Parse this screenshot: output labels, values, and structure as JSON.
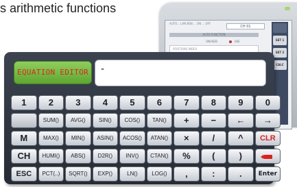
{
  "heading": "s arithmetic functions",
  "device": {
    "top_small": "AUTO...  LAN  BSN  ... ON ... OFF",
    "channel": "CH 01",
    "bar": "AUTO  FUNCTION",
    "opt_unused": "UNUSED",
    "opt_use": "USE",
    "line": "POSITIONS INDEX",
    "side": [
      "SET 1",
      "SET 2",
      "CALC"
    ]
  },
  "editor": {
    "label": "EQUATION EDITOR",
    "value": "-"
  },
  "keypad": {
    "rows": [
      [
        "1",
        "2",
        "3",
        "4",
        "5",
        "6",
        "7",
        "8",
        "9",
        "0"
      ],
      [
        "",
        "SUM()",
        "AVG()",
        "SIN()",
        "COS()",
        "TAN()",
        "+",
        "−",
        "←",
        "→"
      ],
      [
        "M",
        "MAX()",
        "MIN()",
        "ASIN()",
        "ACOS()",
        "ATAN()",
        "×",
        "/",
        "^",
        "CLR"
      ],
      [
        "CH",
        "HUMI()",
        "ABS()",
        "D2R()",
        "INV()",
        "CTAN()",
        "%",
        "(",
        ")",
        ""
      ],
      [
        "ESC",
        "PCT(..)",
        "SQRT()",
        "EXP()",
        "LN()",
        "LOG()",
        ",",
        ":",
        ".",
        "Enter"
      ]
    ],
    "colors": {
      "accent_red": "#d8231d",
      "label_green": "#6cb73f"
    }
  }
}
